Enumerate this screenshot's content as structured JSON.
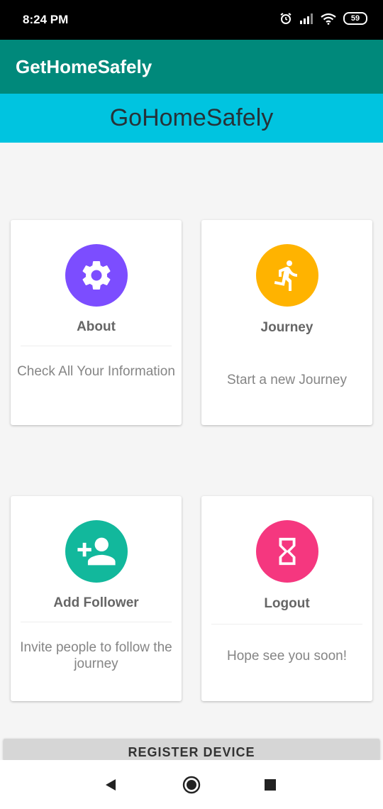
{
  "status_bar": {
    "time": "8:24 PM",
    "battery": "59"
  },
  "app_bar": {
    "title": "GetHomeSafely"
  },
  "banner": {
    "text": "GoHomeSafely"
  },
  "cards": [
    {
      "title": "About",
      "description": "Check All Your Information",
      "icon": "gear-icon",
      "color": "#7c4dff"
    },
    {
      "title": "Journey",
      "description": "Start a new Journey",
      "icon": "running-person-icon",
      "color": "#ffb300"
    },
    {
      "title": "Add Follower",
      "description": "Invite people to follow the journey",
      "icon": "person-add-icon",
      "color": "#12b89c"
    },
    {
      "title": "Logout",
      "description": "Hope see you soon!",
      "icon": "hourglass-icon",
      "color": "#f5377f"
    }
  ],
  "register_button": {
    "label": "REGISTER DEVICE"
  },
  "nav": {
    "back": "back-icon",
    "home": "home-icon",
    "recents": "recents-icon"
  }
}
